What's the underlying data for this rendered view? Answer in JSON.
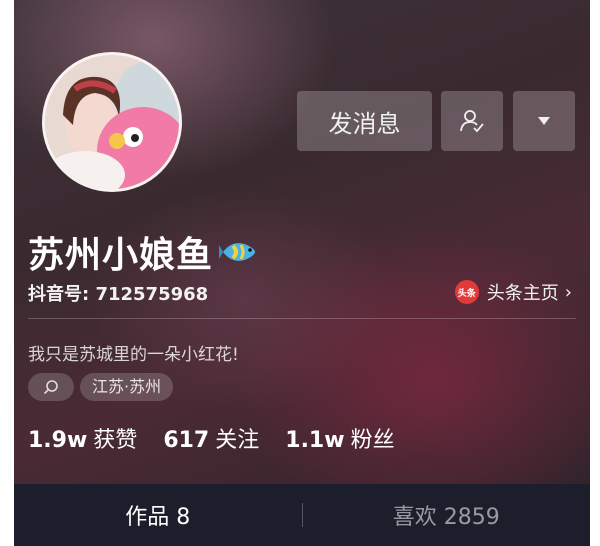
{
  "profile": {
    "name": "苏州小娘鱼",
    "douyin_id_label": "抖音号: 712575968",
    "bio": "我只是苏城里的一朵小红花!",
    "location": "江苏·苏州"
  },
  "actions": {
    "message_label": "发消息",
    "follow_icon": "user-check-icon",
    "more_icon": "caret-down-icon"
  },
  "toutiao": {
    "logo_text": "头条",
    "label": "头条主页"
  },
  "stats": [
    {
      "value": "1.9w",
      "label": "获赞"
    },
    {
      "value": "617",
      "label": "关注"
    },
    {
      "value": "1.1w",
      "label": "粉丝"
    }
  ],
  "tabs": [
    {
      "label": "作品 8",
      "active": true
    },
    {
      "label": "喜欢 2859",
      "active": false
    }
  ],
  "colors": {
    "tab_bar": "#1c1f2b",
    "toutiao_red": "#e23a3a"
  }
}
